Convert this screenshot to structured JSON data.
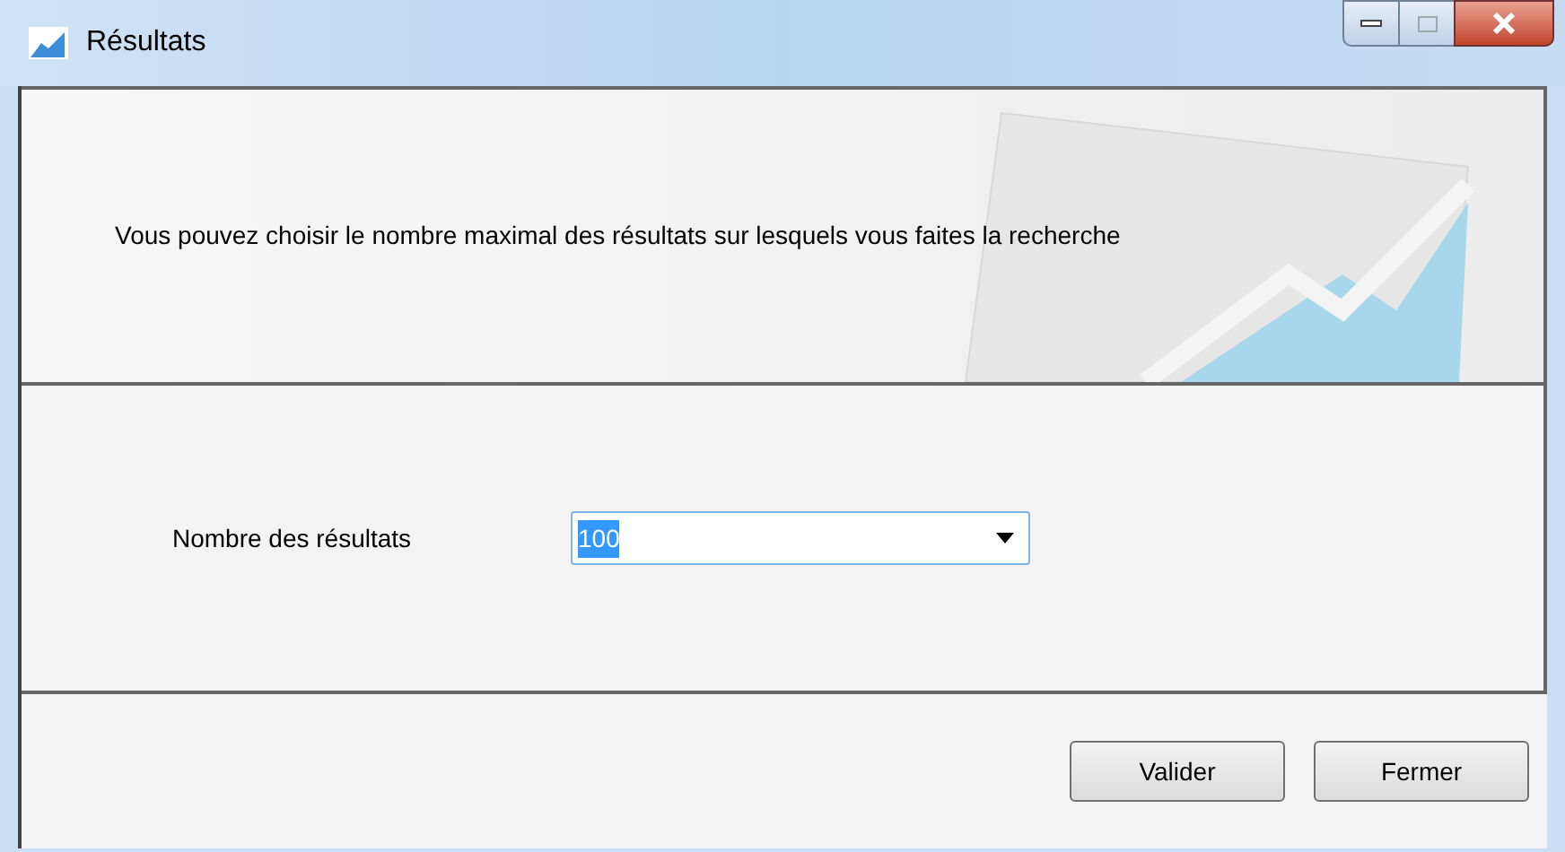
{
  "window": {
    "title": "Résultats"
  },
  "header": {
    "message": "Vous pouvez choisir le nombre maximal des résultats sur lesquels vous faites la recherche"
  },
  "form": {
    "label": "Nombre des résultats",
    "value": "100"
  },
  "buttons": [
    "Valider",
    "Fermer"
  ]
}
